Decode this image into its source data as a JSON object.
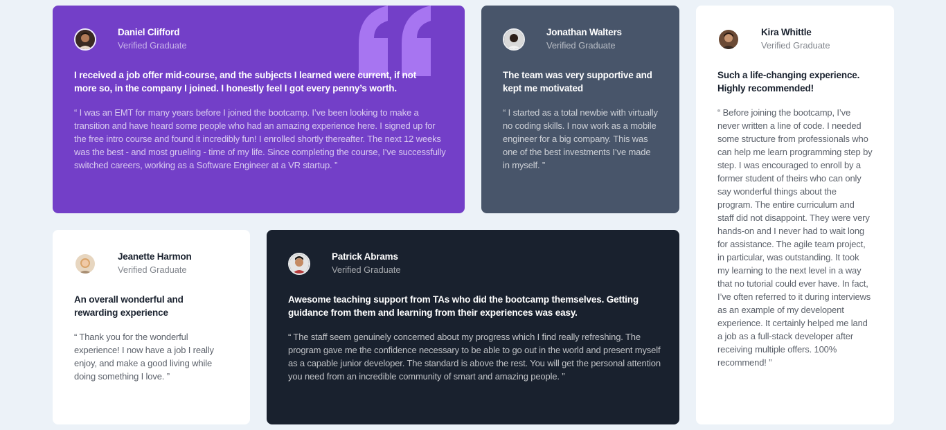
{
  "testimonials": [
    {
      "name": "Daniel Clifford",
      "role": "Verified Graduate",
      "headline": "I received a job offer mid-course, and the subjects I learned were current, if not more so, in the company I joined. I honestly feel I got every penny’s worth.",
      "body": "“ I was an EMT for many years before I joined the bootcamp. I’ve been looking to make a transition and have heard some people who had an amazing experience here. I signed up for the free intro course and found it incredibly fun! I enrolled shortly thereafter. The next 12 weeks was the best - and most grueling - time of my life. Since completing the course, I’ve successfully switched careers, working as a Software Engineer at a VR startup. ”",
      "color": "#733fc8"
    },
    {
      "name": "Jonathan Walters",
      "role": "Verified Graduate",
      "headline": "The team was very supportive and kept me motivated",
      "body": "“ I started as a total newbie with virtually no coding skills. I now work as a mobile engineer for a big company. This was one of the best investments I’ve made in myself. ”",
      "color": "#48556a"
    },
    {
      "name": "Kira Whittle",
      "role": "Verified Graduate",
      "headline": "Such a life-changing experience. Highly recommended!",
      "body": "“ Before joining the bootcamp, I’ve never written a line of code. I needed some structure from professionals who can help me learn programming step by step. I was encouraged to enroll by a former student of theirs who can only say wonderful things about the program. The entire curriculum and staff did not disappoint. They were very hands-on and I never had to wait long for assistance. The agile team project, in particular, was outstanding. It took my learning to the next level in a way that no tutorial could ever have. In fact, I’ve often referred to it during interviews as an example of my developent experience. It certainly helped me land a job as a full-stack developer after receiving multiple offers. 100% recommend! ”",
      "color": "#ffffff"
    },
    {
      "name": "Jeanette Harmon",
      "role": "Verified Graduate",
      "headline": "An overall wonderful and rewarding experience",
      "body": "“ Thank you for the wonderful experience! I now have a job I really enjoy, and make a good living while doing something I love. ”",
      "color": "#ffffff"
    },
    {
      "name": "Patrick Abrams",
      "role": "Verified Graduate",
      "headline": "Awesome teaching support from TAs who did the bootcamp themselves. Getting guidance from them and learning from their experiences was easy.",
      "body": "“ The staff seem genuinely concerned about my progress which I find really refreshing. The program gave me the confidence necessary to be able to go out in the world and present myself as a capable junior developer. The standard is above the rest. You will get the personal attention you need from an incredible community of smart and amazing people. ”",
      "color": "#19212e"
    }
  ]
}
